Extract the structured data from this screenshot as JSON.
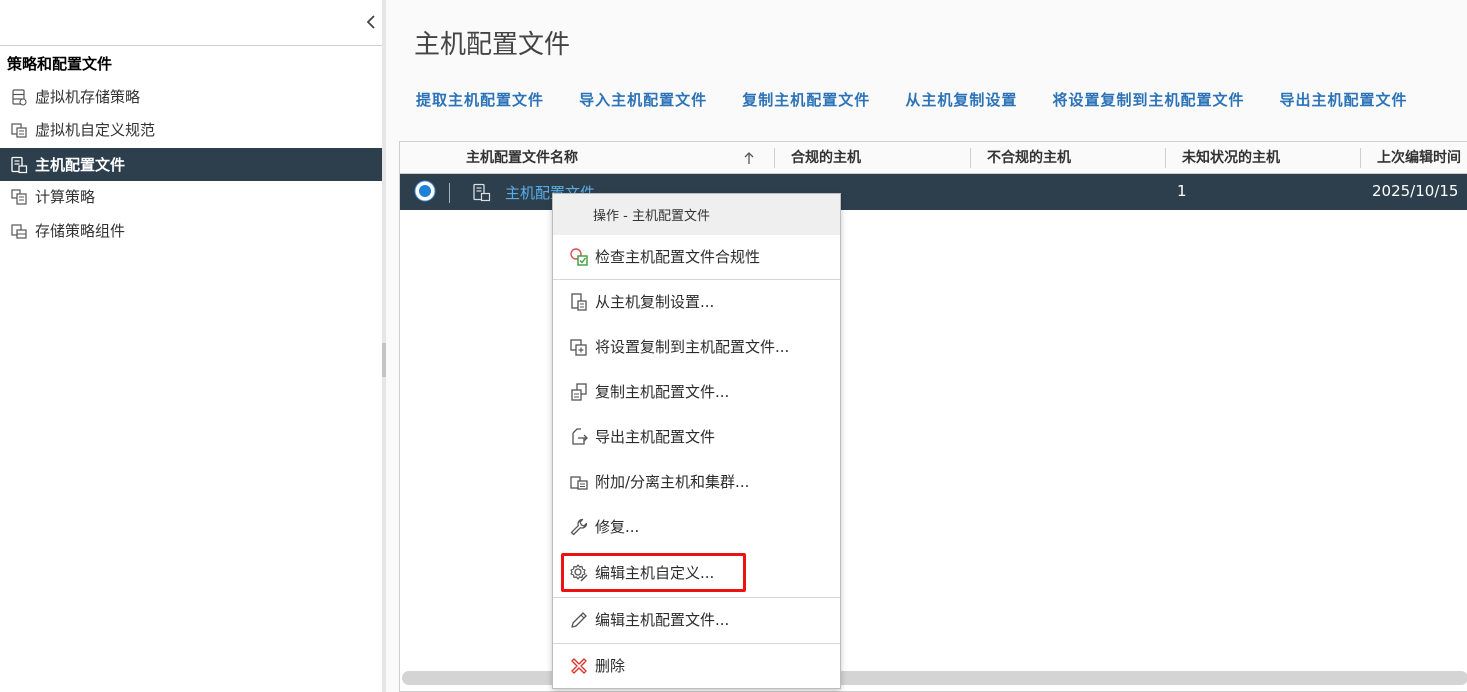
{
  "sidebar": {
    "section_title": "策略和配置文件",
    "items": [
      {
        "label": "虚拟机存储策略",
        "icon": "vm-storage-policy-icon"
      },
      {
        "label": "虚拟机自定义规范",
        "icon": "vm-customization-spec-icon"
      },
      {
        "label": "主机配置文件",
        "icon": "host-profile-icon",
        "active": true
      },
      {
        "label": "计算策略",
        "icon": "compute-policy-icon"
      },
      {
        "label": "存储策略组件",
        "icon": "storage-policy-component-icon"
      }
    ],
    "collapse_icon": "chevron-left-icon"
  },
  "main": {
    "title": "主机配置文件",
    "toolbar": [
      "提取主机配置文件",
      "导入主机配置文件",
      "复制主机配置文件",
      "从主机复制设置",
      "将设置复制到主机配置文件",
      "导出主机配置文件"
    ],
    "grid": {
      "columns": [
        "主机配置文件名称",
        "合规的主机",
        "不合规的主机",
        "未知状况的主机",
        "上次编辑时间"
      ],
      "sort_icon": "arrow-up-icon",
      "rows": [
        {
          "name": "主机配置文件",
          "compliant": "",
          "noncompliant": "",
          "unknown": "1",
          "last_edited": "2025/10/15"
        }
      ]
    }
  },
  "context_menu": {
    "header": "操作 - 主机配置文件",
    "items": [
      {
        "label": "检查主机配置文件合规性",
        "icon": "check-compliance-icon"
      },
      {
        "label": "从主机复制设置...",
        "icon": "copy-from-host-icon"
      },
      {
        "label": "将设置复制到主机配置文件...",
        "icon": "copy-settings-icon"
      },
      {
        "label": "复制主机配置文件...",
        "icon": "duplicate-profile-icon"
      },
      {
        "label": "导出主机配置文件",
        "icon": "export-icon"
      },
      {
        "label": "附加/分离主机和集群...",
        "icon": "attach-detach-icon"
      },
      {
        "label": "修复...",
        "icon": "wrench-icon"
      },
      {
        "label": "编辑主机自定义...",
        "icon": "gear-edit-icon",
        "highlighted": true
      },
      {
        "label": "编辑主机配置文件...",
        "icon": "pencil-icon"
      },
      {
        "label": "删除",
        "icon": "delete-icon"
      }
    ]
  },
  "colors": {
    "active_nav": "#2d3f4d",
    "link_blue": "#2c73b8",
    "selected_row": "#2d3f4d",
    "highlight_box": "#ee1111"
  }
}
